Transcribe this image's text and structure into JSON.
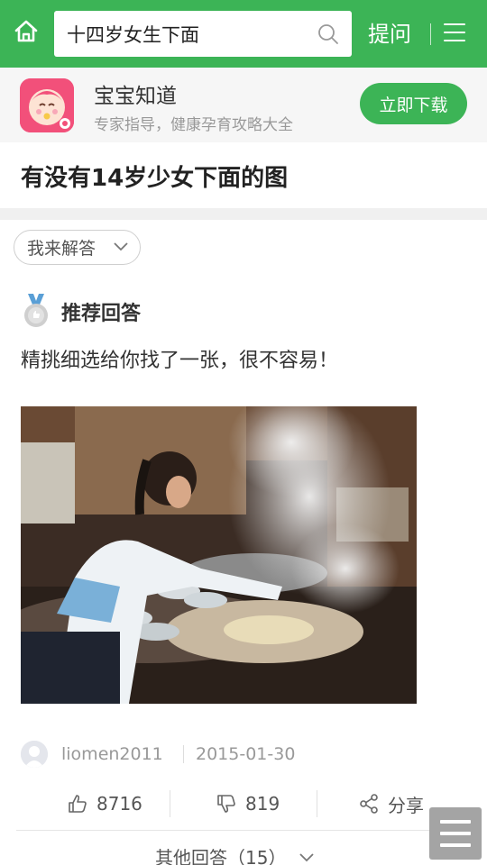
{
  "header": {
    "search_value": "十四岁女生下面",
    "ask_label": "提问",
    "brand_color": "#3cb456"
  },
  "app_banner": {
    "name": "宝宝知道",
    "slogan": "专家指导，健康孕育攻略大全",
    "download_label": "立即下载"
  },
  "question": {
    "title": "有没有14岁少女下面的图",
    "answer_button_label": "我来解答"
  },
  "recommended": {
    "heading": "推荐回答",
    "text": "精挑细选给你找了一张，很不容易！",
    "author": "liomen2011",
    "date": "2015-01-30",
    "likes": "8716",
    "dislikes": "819",
    "share_label": "分享"
  },
  "footer": {
    "more_answers_label": "其他回答（15）"
  },
  "icons": {
    "home": "home-icon",
    "search": "search-icon",
    "menu": "hamburger-icon",
    "medal": "medal-icon",
    "like": "thumbs-up-icon",
    "dislike": "thumbs-down-icon",
    "share": "share-icon"
  }
}
